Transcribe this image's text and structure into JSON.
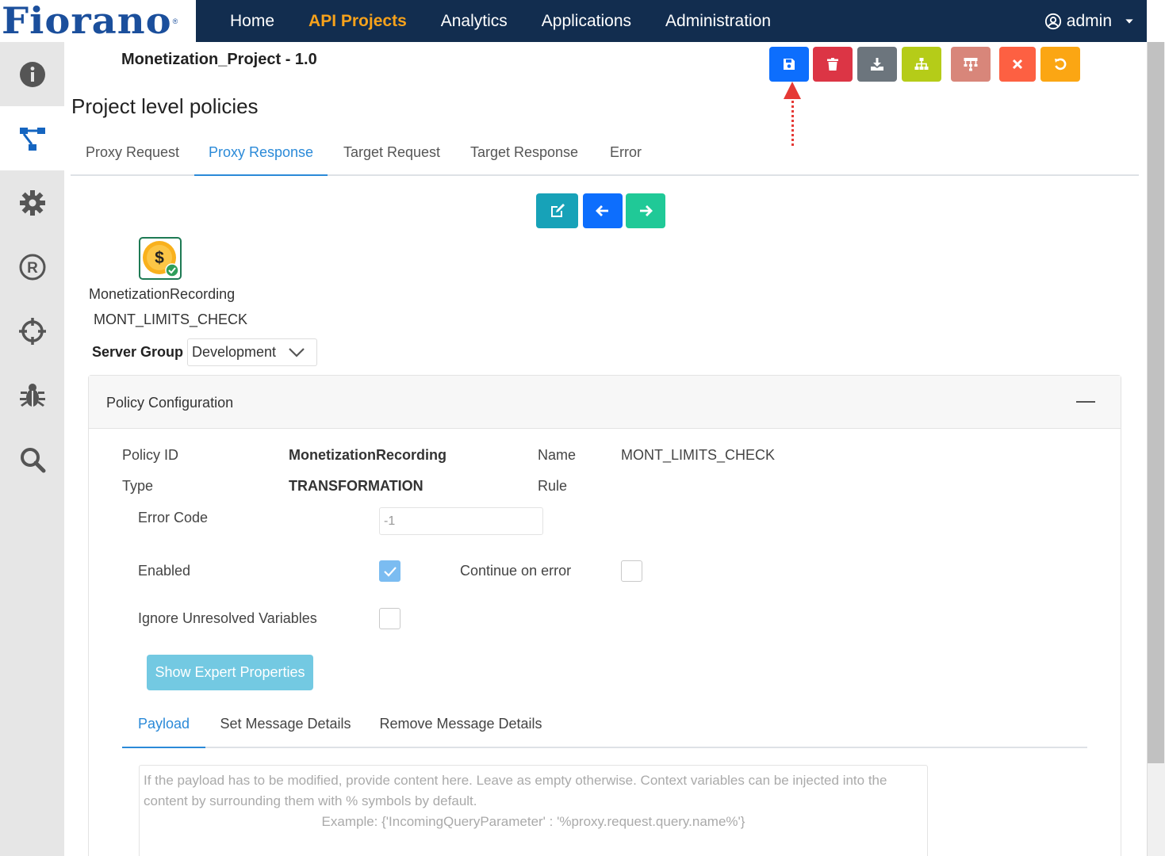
{
  "brand": {
    "logo_text": "Fiorano"
  },
  "nav": {
    "items": [
      "Home",
      "API Projects",
      "Analytics",
      "Applications",
      "Administration"
    ],
    "active_index": 1,
    "user": "admin"
  },
  "sidebar": {
    "icons": [
      "info-icon",
      "flow-icon",
      "gear-icon",
      "registered-icon",
      "crosshair-icon",
      "bug-icon",
      "search-icon"
    ],
    "active_index": 1
  },
  "project": {
    "title": "Monetization_Project - 1.0"
  },
  "page": {
    "title": "Project level policies"
  },
  "toolbar": {
    "buttons": [
      {
        "name": "save-button",
        "icon": "save-icon",
        "color": "#0d6efd"
      },
      {
        "name": "delete-button",
        "icon": "trash-icon",
        "color": "#dc3545"
      },
      {
        "name": "download-button",
        "icon": "download-icon",
        "color": "#6c757d"
      },
      {
        "name": "hierarchy-button",
        "icon": "sitemap-icon",
        "color": "#b5cc18"
      },
      {
        "name": "tree-button",
        "icon": "tree-icon",
        "color": "#d8867a"
      },
      {
        "name": "close-button",
        "icon": "close-icon",
        "color": "#fd6042"
      },
      {
        "name": "undo-button",
        "icon": "undo-icon",
        "color": "#fba613"
      }
    ]
  },
  "tabs": {
    "items": [
      "Proxy Request",
      "Proxy Response",
      "Target Request",
      "Target Response",
      "Error"
    ],
    "active_index": 1
  },
  "controls": {
    "buttons": [
      {
        "name": "edit-button",
        "icon": "edit-icon",
        "color": "#17a2b8"
      },
      {
        "name": "move-left-button",
        "icon": "arrow-left-icon",
        "color": "#0d6efd"
      },
      {
        "name": "move-right-button",
        "icon": "arrow-right-icon",
        "color": "#20c997"
      }
    ]
  },
  "policy_node": {
    "type_label": "MonetizationRecording",
    "name_label": "MONT_LIMITS_CHECK",
    "icon": "dollar-coin-icon"
  },
  "server_group": {
    "label": "Server Group",
    "value": "Development"
  },
  "config": {
    "title": "Policy Configuration",
    "policy_id_label": "Policy ID",
    "policy_id_value": "MonetizationRecording",
    "name_label": "Name",
    "name_value": "MONT_LIMITS_CHECK",
    "type_label": "Type",
    "type_value": "TRANSFORMATION",
    "rule_label": "Rule",
    "error_code_label": "Error Code",
    "error_code_placeholder": "-1",
    "enabled_label": "Enabled",
    "enabled": true,
    "continue_label": "Continue on error",
    "continue_on_error": false,
    "ignore_label": "Ignore Unresolved Variables",
    "ignore_unresolved": false,
    "expert_button": "Show Expert Properties"
  },
  "payload_tabs": {
    "items": [
      "Payload",
      "Set Message Details",
      "Remove Message Details"
    ],
    "active_index": 0
  },
  "payload": {
    "placeholder_line1": "If the payload has to be modified, provide content here. Leave as empty otherwise. Context variables can be injected into the content by surrounding them with % symbols by default.",
    "placeholder_line2": "Example: {'IncomingQueryParameter' : '%proxy.request.query.name%'}"
  }
}
